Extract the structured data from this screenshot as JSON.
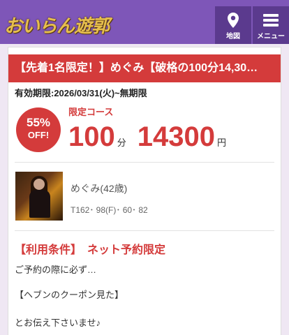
{
  "header": {
    "logo_text": "おいらん遊郭",
    "map_label": "地図",
    "menu_label": "メニュー",
    "map_icon": "map-pin-icon",
    "menu_icon": "hamburger-menu-icon"
  },
  "coupon": {
    "title": "【先着1名限定！】めぐみ【破格の100分14,30…",
    "validity": "有効期限:2026/03/31(火)~無期限",
    "discount_pct": "55%",
    "discount_off": "OFF!",
    "course_label": "限定コース",
    "duration": "100",
    "duration_unit": "分",
    "price": "14300",
    "price_unit": "円"
  },
  "girl": {
    "name": "めぐみ(42歳)",
    "spec": "T162･ 98(F)･ 60･ 82"
  },
  "conditions": {
    "title": "【利用条件】　ネット予約限定",
    "lines": [
      "ご予約の際に必ず…",
      "【ヘブンのクーポン見た】",
      "とお伝え下さいませ♪"
    ]
  },
  "colors": {
    "header_bg": "#7e56b8",
    "header_button_bg": "#5b3a8e",
    "accent_red": "#d43b3b",
    "logo_gold": "#e7bf4e"
  }
}
